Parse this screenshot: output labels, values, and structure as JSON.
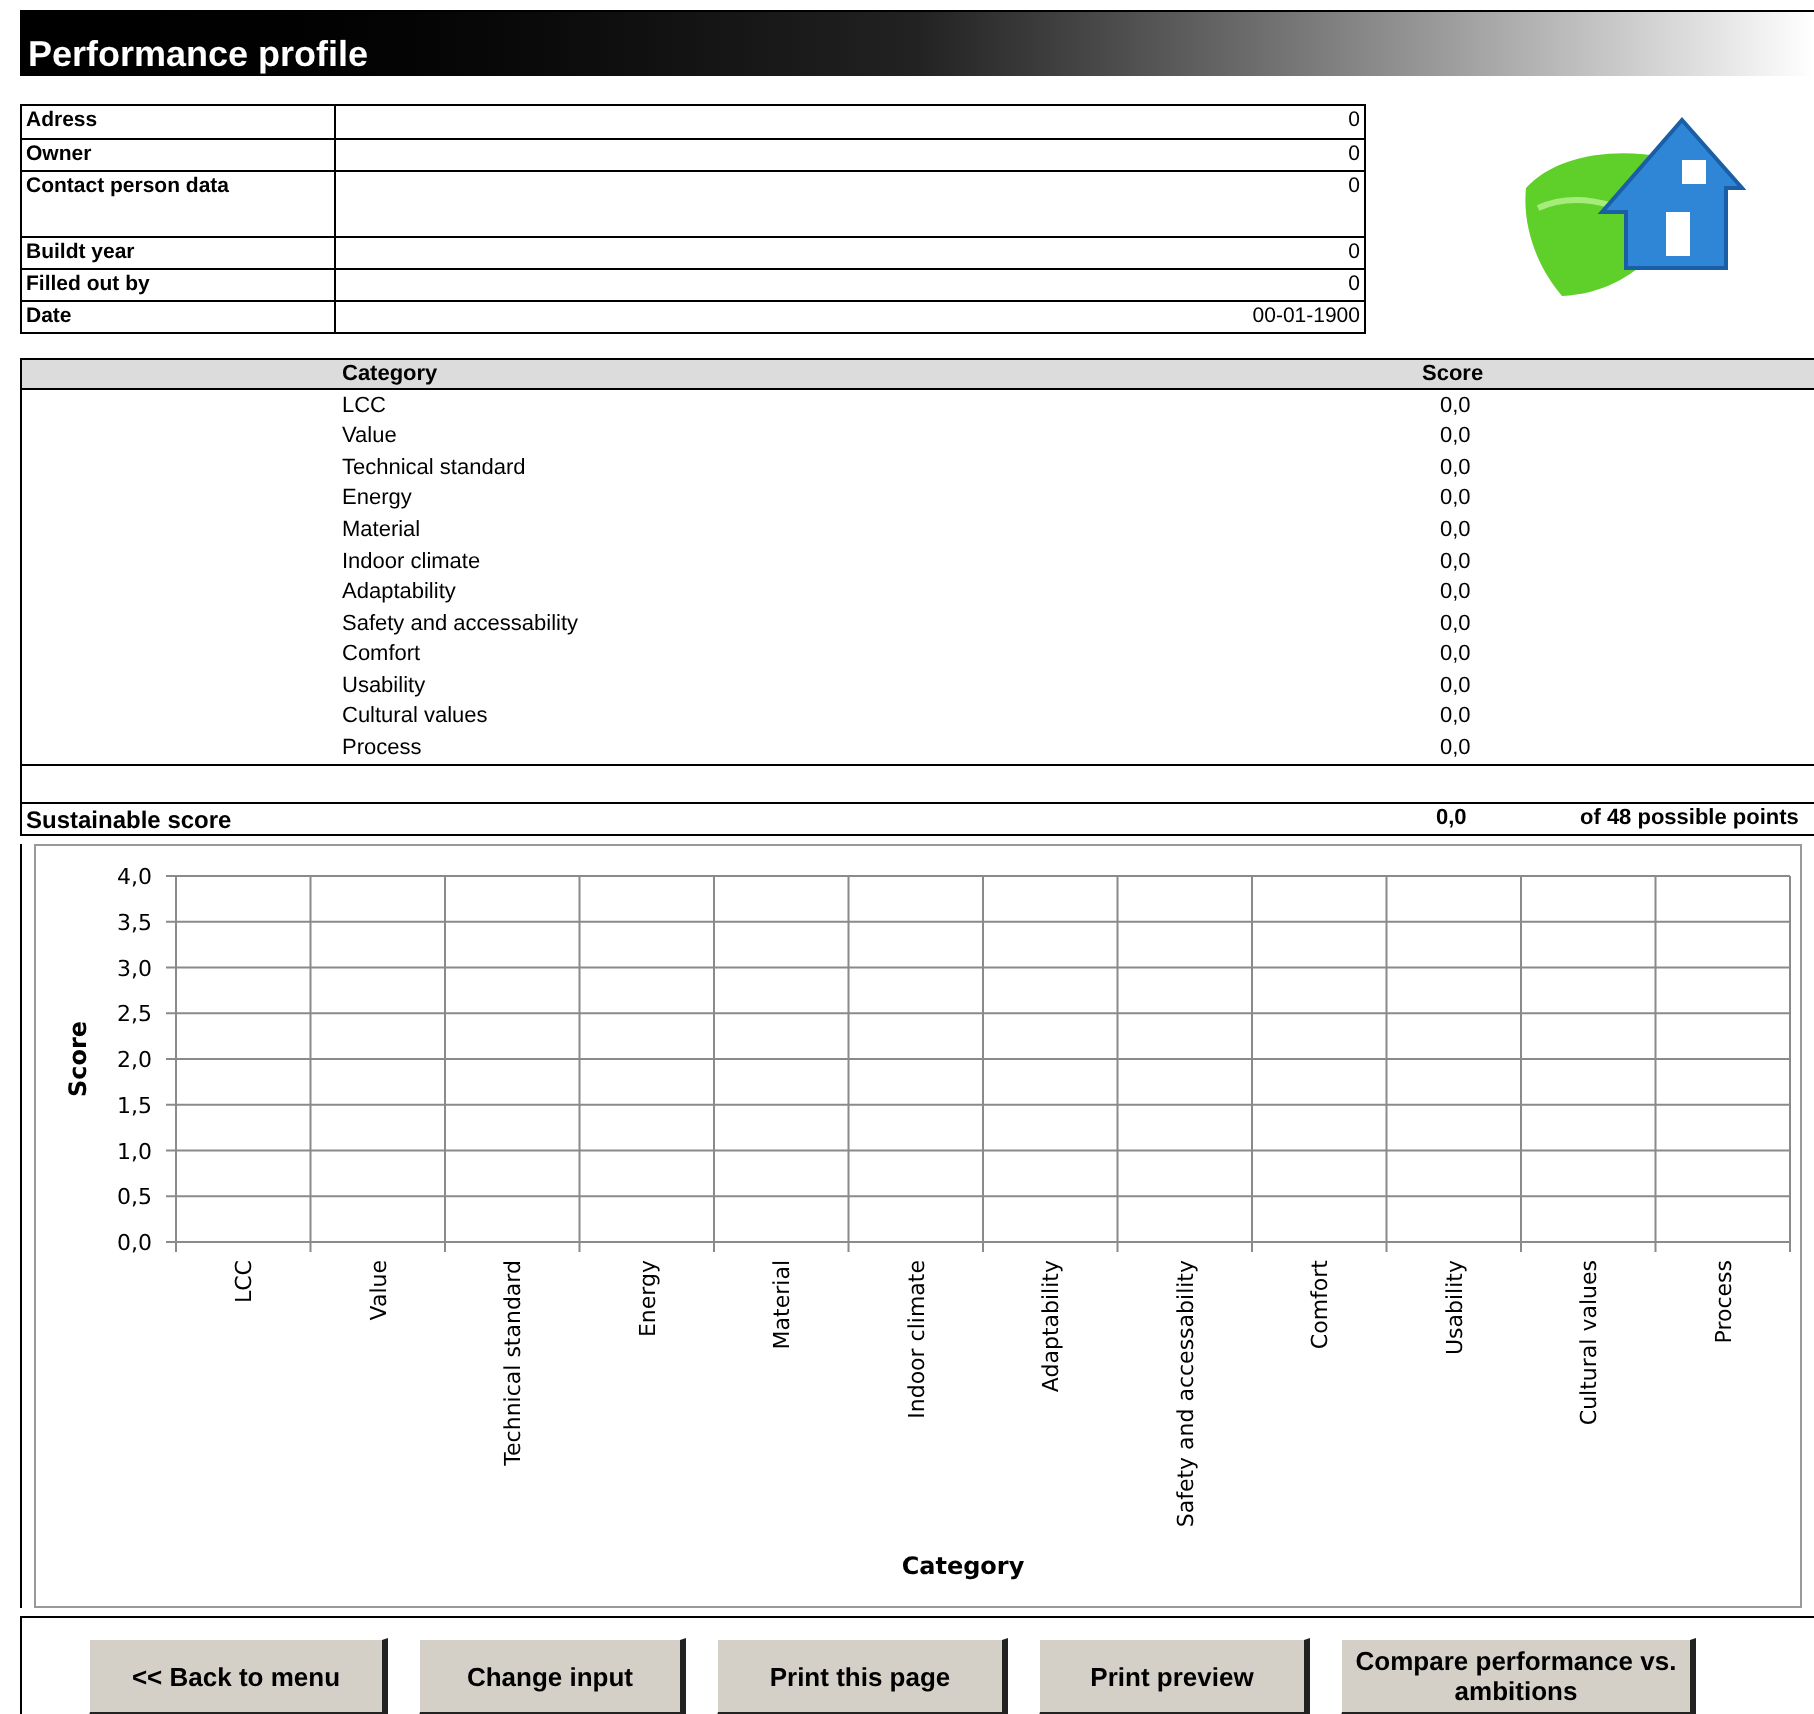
{
  "title": "Performance profile",
  "info": [
    {
      "label": "Adress",
      "value": "0",
      "kind": "single"
    },
    {
      "label": "Owner",
      "value": "0",
      "kind": "single"
    },
    {
      "label": "Contact person data",
      "value": "0",
      "kind": "tall"
    },
    {
      "label": "Buildt year",
      "value": "0",
      "kind": "single"
    },
    {
      "label": "Filled out by",
      "value": "0",
      "kind": "single"
    },
    {
      "label": "Date",
      "value": "00-01-1900",
      "kind": "single"
    }
  ],
  "scores": {
    "columns": [
      "Category",
      "Score"
    ],
    "rows": [
      {
        "category": "LCC",
        "score": "0,0"
      },
      {
        "category": "Value",
        "score": "0,0"
      },
      {
        "category": "Technical standard",
        "score": "0,0"
      },
      {
        "category": "Energy",
        "score": "0,0"
      },
      {
        "category": "Material",
        "score": "0,0"
      },
      {
        "category": "Indoor climate",
        "score": "0,0"
      },
      {
        "category": "Adaptability",
        "score": "0,0"
      },
      {
        "category": "Safety and accessability",
        "score": "0,0"
      },
      {
        "category": "Comfort",
        "score": "0,0"
      },
      {
        "category": "Usability",
        "score": "0,0"
      },
      {
        "category": "Cultural values",
        "score": "0,0"
      },
      {
        "category": "Process",
        "score": "0,0"
      }
    ]
  },
  "summary": {
    "label": "Sustainable score",
    "score": "0,0",
    "note": "of 48 possible points"
  },
  "chart": {
    "chart_data": {
      "type": "bar",
      "xlabel": "Category",
      "ylabel": "Score",
      "categories": [
        "LCC",
        "Value",
        "Technical standard",
        "Energy",
        "Material",
        "Indoor climate",
        "Adaptability",
        "Safety and accessability",
        "Comfort",
        "Usability",
        "Cultural values",
        "Process"
      ],
      "values": [
        0,
        0,
        0,
        0,
        0,
        0,
        0,
        0,
        0,
        0,
        0,
        0
      ],
      "ylim": [
        0,
        4
      ],
      "grid": true,
      "yticks": [
        {
          "value": 0,
          "label": "0,0"
        },
        {
          "value": 0.5,
          "label": "0,5"
        },
        {
          "value": 1,
          "label": "1,0"
        },
        {
          "value": 1.5,
          "label": "1,5"
        },
        {
          "value": 2,
          "label": "2,0"
        },
        {
          "value": 2.5,
          "label": "2,5"
        },
        {
          "value": 3,
          "label": "3,0"
        },
        {
          "value": 3.5,
          "label": "3,5"
        },
        {
          "value": 4,
          "label": "4,0"
        }
      ]
    }
  },
  "buttons": [
    {
      "label": "<< Back to menu"
    },
    {
      "label": "Change input"
    },
    {
      "label": "Print this page"
    },
    {
      "label": "Print preview"
    },
    {
      "label": "Compare performance vs. ambitions"
    }
  ]
}
